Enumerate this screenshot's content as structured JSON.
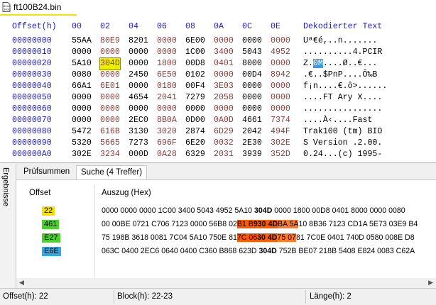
{
  "file_tab": {
    "title": "ft100B24.bin",
    "icon": "binary-file-icon"
  },
  "hex": {
    "header": {
      "offset": "Offset(h)",
      "cols": [
        "00",
        "02",
        "04",
        "06",
        "08",
        "0A",
        "0C",
        "0E"
      ],
      "text": "Dekodierter Text"
    },
    "rows": [
      {
        "offset": "00000000",
        "cells": [
          "55AA",
          "80E9",
          "8201",
          "0000",
          "6E00",
          "0000",
          "0000",
          "0000"
        ],
        "text": "Uª€é,..n......."
      },
      {
        "offset": "00000010",
        "cells": [
          "0000",
          "0000",
          "0000",
          "0000",
          "1C00",
          "3400",
          "5043",
          "4952"
        ],
        "text": "..........4.PCIR"
      },
      {
        "offset": "00000020",
        "cells": [
          "5A10",
          "304D",
          "0000",
          "1800",
          "00D8",
          "0401",
          "8000",
          "0000"
        ],
        "text": "Z.0M....Ø..€..."
      },
      {
        "offset": "00000030",
        "cells": [
          "0080",
          "0000",
          "2450",
          "6E50",
          "0102",
          "0000",
          "00D4",
          "8942"
        ],
        "text": ".€..$PnP....Ô‰B"
      },
      {
        "offset": "00000040",
        "cells": [
          "66A1",
          "6E01",
          "0000",
          "0180",
          "00F4",
          "3E03",
          "0000",
          "0000"
        ],
        "text": "f¡n....€.ô>......"
      },
      {
        "offset": "00000050",
        "cells": [
          "0000",
          "0000",
          "4654",
          "2041",
          "7279",
          "2058",
          "0000",
          "0000"
        ],
        "text": "....FT Ary X...."
      },
      {
        "offset": "00000060",
        "cells": [
          "0000",
          "0000",
          "0000",
          "0000",
          "0000",
          "0000",
          "0000",
          "0000"
        ],
        "text": "................"
      },
      {
        "offset": "00000070",
        "cells": [
          "0000",
          "0000",
          "2EC0",
          "8B0A",
          "0D00",
          "0A0D",
          "4661",
          "7374"
        ],
        "text": "....À‹....Fast"
      },
      {
        "offset": "00000080",
        "cells": [
          "5472",
          "616B",
          "3130",
          "3020",
          "2874",
          "6D29",
          "2042",
          "494F"
        ],
        "text": "Trak100 (tm) BIO"
      },
      {
        "offset": "00000090",
        "cells": [
          "5320",
          "5665",
          "7273",
          "696F",
          "6E20",
          "0032",
          "2E30",
          "302E"
        ],
        "text": "S Version .2.00."
      },
      {
        "offset": "000000A0",
        "cells": [
          "302E",
          "3234",
          "000D",
          "0A28",
          "6329",
          "2031",
          "3939",
          "352D"
        ],
        "text": "0.24...(c) 1995-"
      }
    ]
  },
  "side_label": "Ergebnisse",
  "bottom_tabs": [
    "Prüfsummen",
    "Suche (4 Treffer)"
  ],
  "results": {
    "col_offset": "Offset",
    "col_excerpt": "Auszug (Hex)",
    "rows": [
      {
        "offset": "22",
        "color": "#f5e000",
        "pre": "0000 0000 0000 1C00 3400 5043 4952 5A10 ",
        "match": "304D",
        "post": " 0000 1800 00D8 0401 8000 0000 0080"
      },
      {
        "offset": "461",
        "color": "#49d22a",
        "pre": "00 00BE 0721 C706 7123 0000 56B8 02",
        "o1": "B1 B",
        "match": "930 4D",
        "o2": "BA 5A",
        "post": "10 8B36 7123 CD1A 5E73 03E9 B4"
      },
      {
        "offset": "E27",
        "color": "#49d22a",
        "pre": "75 198B 3618 0081 7C04 5A10 750E 81",
        "o1": "7C 06",
        "match": "30 4D",
        "o2": "75 07",
        "post": "81 7C0E 0401 740D 0580 008E D8"
      },
      {
        "offset": "E6E",
        "color": "#2fa8e8",
        "pre": "063C 0400 2EC6 0640 0400 C360 B868 623D ",
        "match": "304D",
        "post": " 752B BE07 218B 5408 E824 0083 C62A"
      }
    ]
  },
  "status": {
    "offset": "Offset(h): 22",
    "block": "Block(h): 22-23",
    "length": "Länge(h): 2"
  },
  "colors": {
    "accent_blue": "#1a1adf",
    "yellow": "#f5e000",
    "orange": "#ff5a00"
  }
}
